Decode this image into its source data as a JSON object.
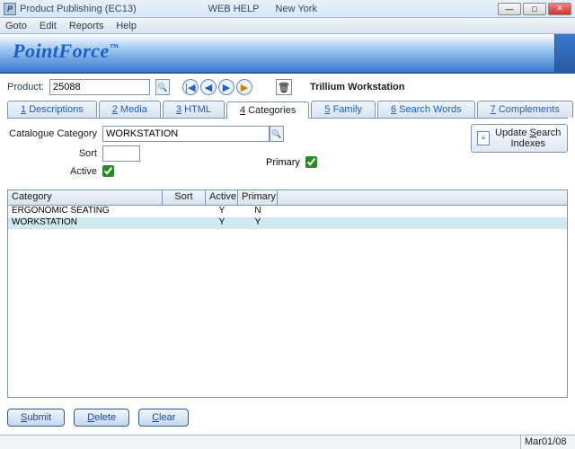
{
  "window": {
    "title": "Product Publishing (EC13)",
    "center_labels": [
      "WEB HELP",
      "New York"
    ],
    "icon_char": "P"
  },
  "menu": {
    "items": [
      "Goto",
      "Edit",
      "Reports",
      "Help"
    ]
  },
  "brand": "PointForce",
  "product": {
    "label": "Product:",
    "value": "25088",
    "name": "Trillium Workstation",
    "nav_icons": {
      "first": "|◀",
      "prev": "◀",
      "next": "▶",
      "play": "▶"
    },
    "trash_icon": "🗑"
  },
  "tabs": [
    {
      "key": "1",
      "label": "Descriptions"
    },
    {
      "key": "2",
      "label": "Media"
    },
    {
      "key": "3",
      "label": "HTML"
    },
    {
      "key": "4",
      "label": "Categories",
      "active": true
    },
    {
      "key": "5",
      "label": "Family"
    },
    {
      "key": "6",
      "label": "Search Words"
    },
    {
      "key": "7",
      "label": "Complements"
    }
  ],
  "form": {
    "category_label": "Catalogue Category",
    "category_value": "WORKSTATION",
    "sort_label": "Sort",
    "sort_value": "",
    "active_label": "Active",
    "active_checked": true,
    "primary_label": "Primary",
    "primary_checked": true
  },
  "update_button": {
    "line1": "Update Search",
    "line2": "Indexes",
    "underline_char": "S"
  },
  "grid": {
    "columns": [
      "Category",
      "Sort",
      "Active",
      "Primary"
    ],
    "rows": [
      {
        "category": "ERGONOMIC SEATING",
        "sort": "",
        "active": "Y",
        "primary": "N",
        "selected": false
      },
      {
        "category": "WORKSTATION",
        "sort": "",
        "active": "Y",
        "primary": "Y",
        "selected": true
      }
    ]
  },
  "buttons": {
    "submit": "Submit",
    "delete": "Delete",
    "clear": "Clear",
    "submit_u": "S",
    "delete_u": "D",
    "clear_u": "C"
  },
  "status": {
    "date": "Mar01/08"
  }
}
